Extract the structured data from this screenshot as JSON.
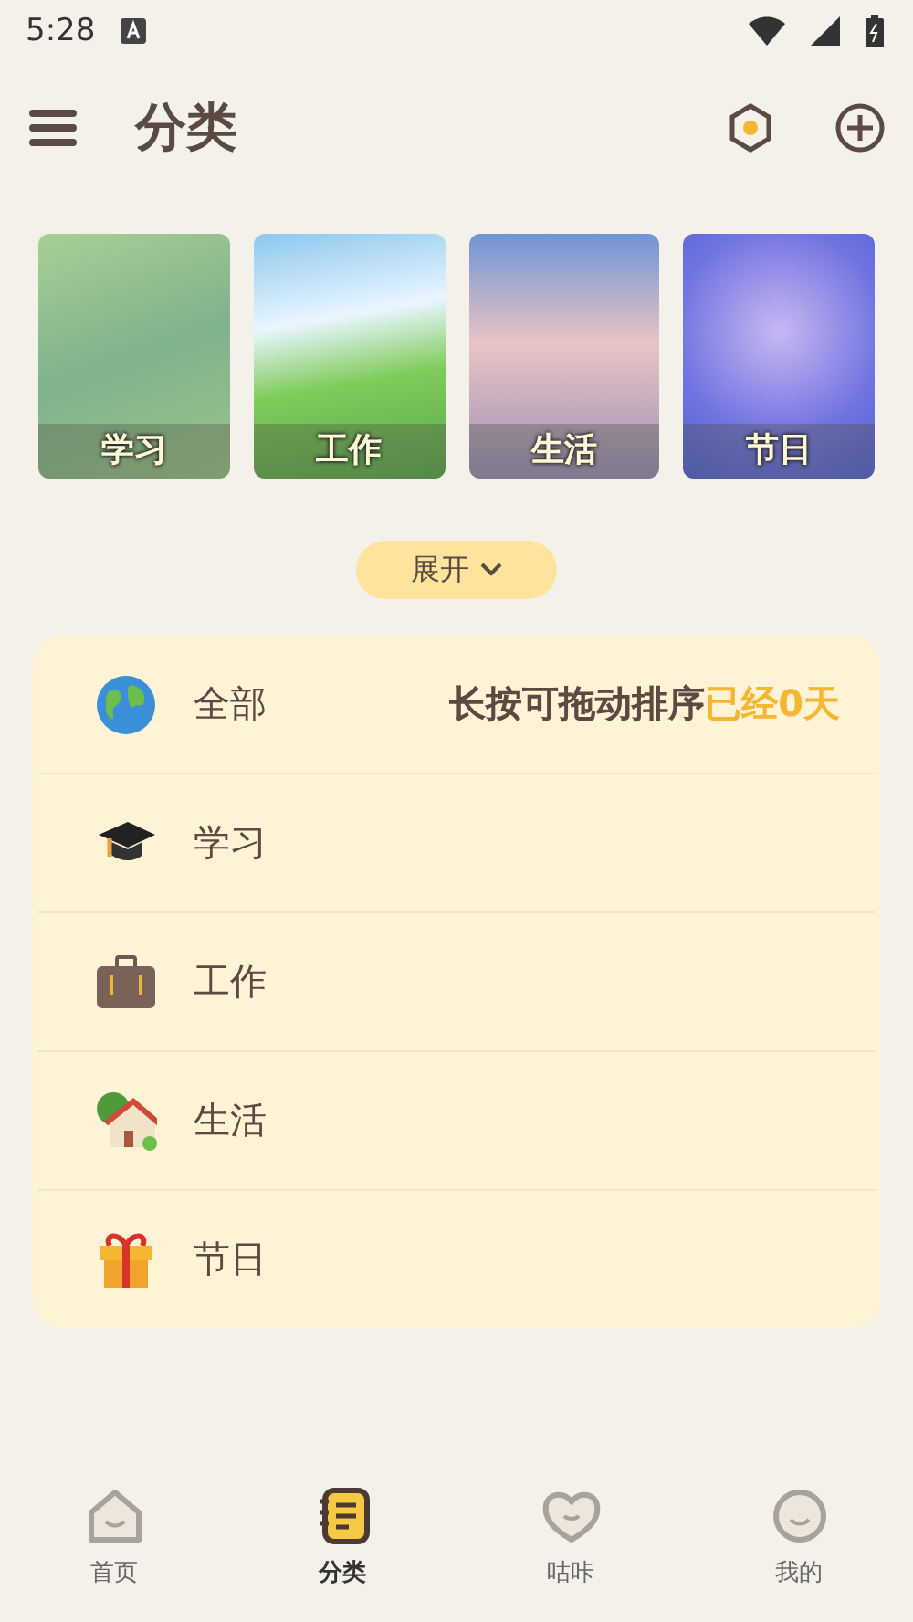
{
  "status_bar": {
    "time": "5:28"
  },
  "header": {
    "title": "分类"
  },
  "covers": [
    {
      "label": "学习",
      "kind": "meadow"
    },
    {
      "label": "工作",
      "kind": "hill"
    },
    {
      "label": "生活",
      "kind": "cloud"
    },
    {
      "label": "节日",
      "kind": "fireworks"
    }
  ],
  "expand_button": {
    "label": "展开"
  },
  "categories": [
    {
      "name": "全部",
      "kind": "globe",
      "hint": "长按可拖动排序",
      "days": "已经0天"
    },
    {
      "name": "学习",
      "kind": "cap"
    },
    {
      "name": "工作",
      "kind": "briefcase"
    },
    {
      "name": "生活",
      "kind": "house"
    },
    {
      "name": "节日",
      "kind": "gift"
    }
  ],
  "nav": [
    {
      "label": "首页",
      "kind": "home",
      "selected": false
    },
    {
      "label": "分类",
      "kind": "notebook",
      "selected": true
    },
    {
      "label": "咕咔",
      "kind": "heart",
      "selected": false
    },
    {
      "label": "我的",
      "kind": "face",
      "selected": false
    }
  ]
}
